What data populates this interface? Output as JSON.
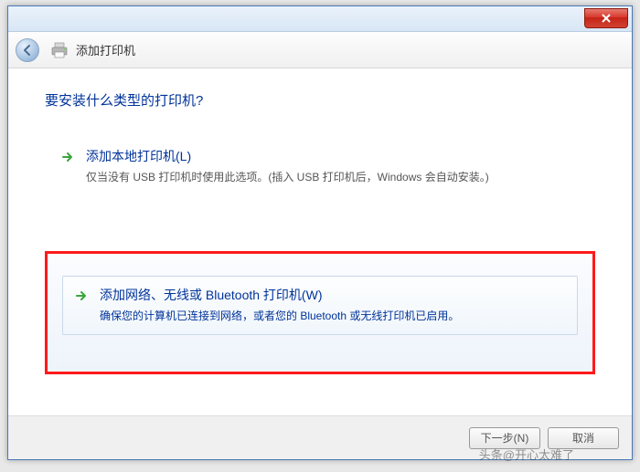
{
  "window": {
    "header_title": "添加打印机"
  },
  "content": {
    "question": "要安装什么类型的打印机?"
  },
  "options": [
    {
      "title": "添加本地打印机(L)",
      "description": "仅当没有 USB 打印机时使用此选项。(插入 USB 打印机后，Windows 会自动安装。)"
    },
    {
      "title": "添加网络、无线或 Bluetooth 打印机(W)",
      "description": "确保您的计算机已连接到网络，或者您的 Bluetooth 或无线打印机已启用。"
    }
  ],
  "footer": {
    "next": "下一步(N)",
    "cancel": "取消"
  },
  "watermark": "头条@开心太难了"
}
